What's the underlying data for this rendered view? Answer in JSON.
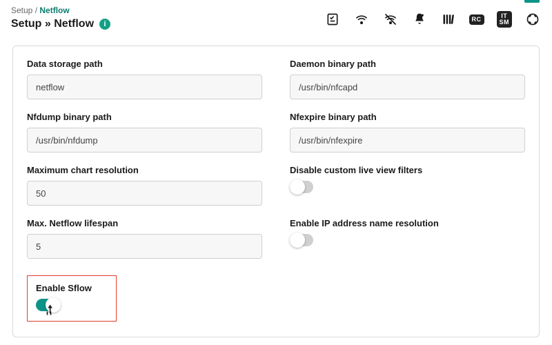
{
  "breadcrumb": {
    "parent": "Setup",
    "sep": "/",
    "current": "Netflow"
  },
  "page_title_prefix": "Setup »",
  "page_title_current": "Netflow",
  "info_glyph": "i",
  "toolbar_icons": {
    "checklist": "checklist",
    "wifi": "signal",
    "wifi_off": "no-signal",
    "bell": "notifications",
    "library": "library",
    "rc": "RC",
    "itsm": "IT\nSM",
    "help": "help"
  },
  "fields": {
    "data_storage_path": {
      "label": "Data storage path",
      "value": "netflow"
    },
    "daemon_binary_path": {
      "label": "Daemon binary path",
      "value": "/usr/bin/nfcapd"
    },
    "nfdump_binary_path": {
      "label": "Nfdump binary path",
      "value": "/usr/bin/nfdump"
    },
    "nfexpire_binary_path": {
      "label": "Nfexpire binary path",
      "value": "/usr/bin/nfexpire"
    },
    "max_chart_resolution": {
      "label": "Maximum chart resolution",
      "value": "50"
    },
    "disable_live_filters": {
      "label": "Disable custom live view filters",
      "on": false
    },
    "max_lifespan": {
      "label": "Max. Netflow lifespan",
      "value": "5"
    },
    "enable_resolution": {
      "label": "Enable IP address name resolution",
      "on": false
    },
    "enable_sflow": {
      "label": "Enable Sflow",
      "on": true
    }
  }
}
